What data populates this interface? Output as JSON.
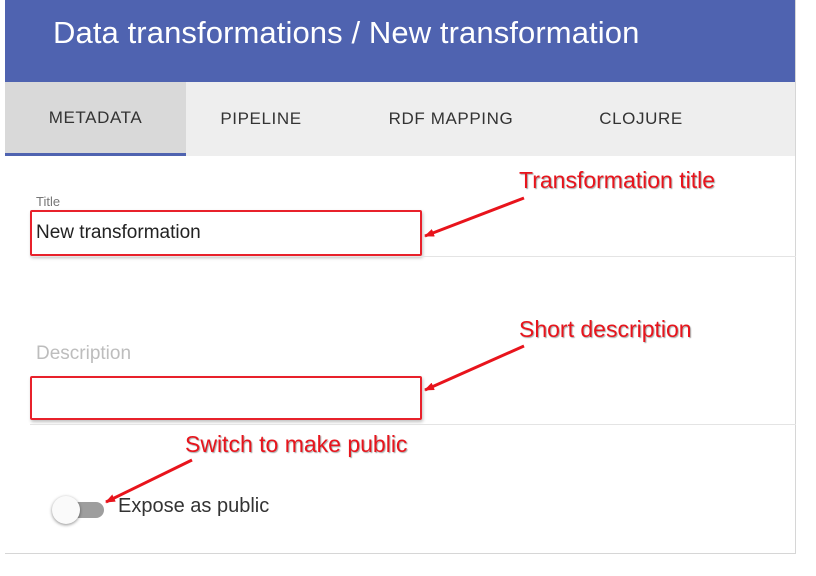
{
  "header": {
    "title": "Data transformations / New transformation"
  },
  "tabs": [
    {
      "label": "METADATA",
      "active": true
    },
    {
      "label": "PIPELINE",
      "active": false
    },
    {
      "label": "RDF MAPPING",
      "active": false
    },
    {
      "label": "CLOJURE",
      "active": false
    }
  ],
  "form": {
    "title_label": "Title",
    "title_value": "New transformation",
    "description_label": "Description",
    "description_value": "",
    "public_label": "Expose as public",
    "public_on": false
  },
  "annotations": {
    "title": "Transformation title",
    "description": "Short description",
    "public": "Switch to make public"
  },
  "colors": {
    "header_bg": "#4f63b0",
    "annotation_red": "#e8141c",
    "highlight_border": "#e8212b"
  }
}
